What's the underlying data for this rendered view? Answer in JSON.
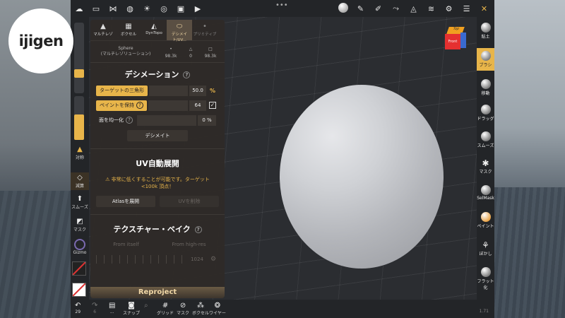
{
  "logo": {
    "text": "ijigen"
  },
  "topbar": {
    "dots": "•••",
    "left_icons": [
      "folder-icon",
      "share-icon",
      "scene-icon",
      "background-icon",
      "light-icon",
      "material-icon",
      "image-icon",
      "video-icon"
    ],
    "right_icons": [
      "matcap-icon",
      "pen-icon",
      "pencil-icon",
      "stroke-icon",
      "layers-alt-icon",
      "layers-icon",
      "gear-icon",
      "list-icon",
      "tools-icon"
    ]
  },
  "panel": {
    "tabs": [
      {
        "label": "マルチレゾ",
        "icon": "multires-icon"
      },
      {
        "label": "ボクセル",
        "icon": "voxel-icon"
      },
      {
        "label": "DynTopo",
        "icon": "dyntopo-icon"
      },
      {
        "label": "デシメイト/UV...",
        "icon": "decimate-icon"
      },
      {
        "label": "プリミティブ",
        "icon": "primitive-icon"
      }
    ],
    "mesh_name": "Sphere",
    "mesh_sub": "(マルチレゾリューション)",
    "stat_vertices": "98.3k",
    "stat_triangles": "0",
    "stat_quads": "98.3k",
    "decimation": {
      "title": "デシメーション",
      "target_label": "ターゲットの三角形",
      "target_value": "50.0",
      "target_unit": "%",
      "keep_paint_label": "ペイントを保持",
      "keep_paint_value": "64",
      "keep_paint_checked": "✓",
      "uniform_label": "面を均一化",
      "uniform_value": "0 %",
      "decimate_button": "デシメイト"
    },
    "uv": {
      "title": "UV自動展開",
      "warning": "⚠ 非常に低くすることが可能です。ターゲット <100k 頂点！",
      "unwrap_button": "Atlasを展開",
      "delete_button": "UVを削除"
    },
    "texture_bake": {
      "title": "テクスチャー・ベイク",
      "from_itself": "From itself",
      "from_highres": "From high-res",
      "resolution_value": "1024"
    },
    "reproject": "Reproject"
  },
  "left_strip": {
    "symmetry": "対称",
    "decrease": "減算",
    "smooth": "スムーズ",
    "mask": "マスク",
    "gizmo": "Gizmo"
  },
  "right_tools": [
    {
      "label": "粘土",
      "icon": "clay-icon"
    },
    {
      "label": "ブラシ",
      "icon": "brush-icon"
    },
    {
      "label": "移動",
      "icon": "move-icon"
    },
    {
      "label": "ドラッグ",
      "icon": "drag-icon"
    },
    {
      "label": "スムーズ",
      "icon": "smooth-icon"
    },
    {
      "label": "マスク",
      "icon": "mask-icon"
    },
    {
      "label": "SelMask",
      "icon": "selmask-icon"
    },
    {
      "label": "ペイント",
      "icon": "paint-icon"
    },
    {
      "label": "ぼかし",
      "icon": "blur-icon"
    },
    {
      "label": "フラット化",
      "icon": "flatten-icon"
    }
  ],
  "cube": {
    "top": "Top",
    "front": "Front"
  },
  "bottombar": {
    "undo_count": "29",
    "redo_count": "6",
    "snap": "スナップ",
    "grid": "グリッド",
    "mask": "マスク",
    "voxel": "ボクセル",
    "wire": "ワイヤー",
    "version": "1.71"
  },
  "colors": {
    "accent": "#e8b54a",
    "panel": "#2f2b28",
    "toolbar": "#232528"
  }
}
